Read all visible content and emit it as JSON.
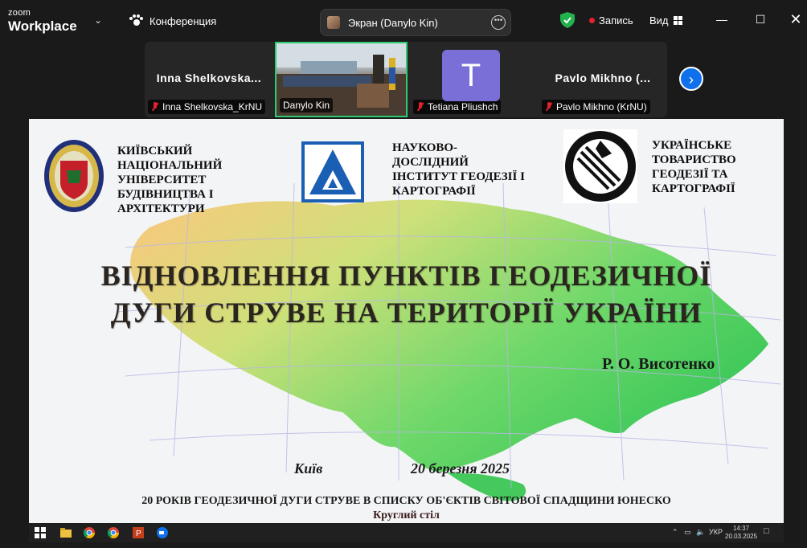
{
  "app": {
    "brand_top": "zoom",
    "brand_bottom": "Workplace"
  },
  "meeting": {
    "title": "Конференция",
    "screen_share_label": "Экран (Danylo Kin)",
    "record_label": "Запись",
    "view_label": "Вид"
  },
  "participants": [
    {
      "display": "Inna Shelkovska...",
      "label": "Inna Shelkovska_KrNU"
    },
    {
      "display": "",
      "label": "Danylo Kin"
    },
    {
      "display": "T",
      "label": "Tetiana Pliushch"
    },
    {
      "display": "Pavlo Mikhno (...",
      "label": "Pavlo Mikhno (KrNU)"
    }
  ],
  "slide": {
    "org1": [
      "КИЇВСЬКИЙ",
      "НАЦІОНАЛЬНИЙ",
      "УНІВЕРСИТЕТ",
      "БУДІВНИЦТВА І",
      "АРХІТЕКТУРИ"
    ],
    "org2": [
      "НАУКОВО-",
      "ДОСЛІДНИЙ",
      "ІНСТИТУТ ГЕОДЕЗІЇ І",
      "КАРТОГРАФІЇ"
    ],
    "org3": [
      "УКРАЇНСЬКЕ",
      "ТОВАРИСТВО",
      "ГЕОДЕЗІЇ ТА",
      "КАРТОГРАФІЇ"
    ],
    "title_line1": "ВІДНОВЛЕННЯ ПУНКТІВ ГЕОДЕЗИЧНОЇ",
    "title_line2": "ДУГИ СТРУВЕ НА ТЕРИТОРІЇ УКРАЇНИ",
    "author": "Р. О. Висотенко",
    "city": "Київ",
    "date": "20 березня 2025",
    "footer1": "20 РОКІВ ГЕОДЕЗИЧНОЇ ДУГИ СТРУВЕ В СПИСКУ ОБ'ЄКТІВ СВІТОВОЇ СПАДЩИНИ ЮНЕСКО",
    "footer2": "Круглий стіл"
  },
  "taskbar": {
    "lang": "УКР",
    "time": "14:37",
    "date": "20.03.2025"
  },
  "colors": {
    "accent": "#0e71eb",
    "active_border": "#2ecc71",
    "record": "#e5212d",
    "avatar": "#7a6fd6"
  }
}
